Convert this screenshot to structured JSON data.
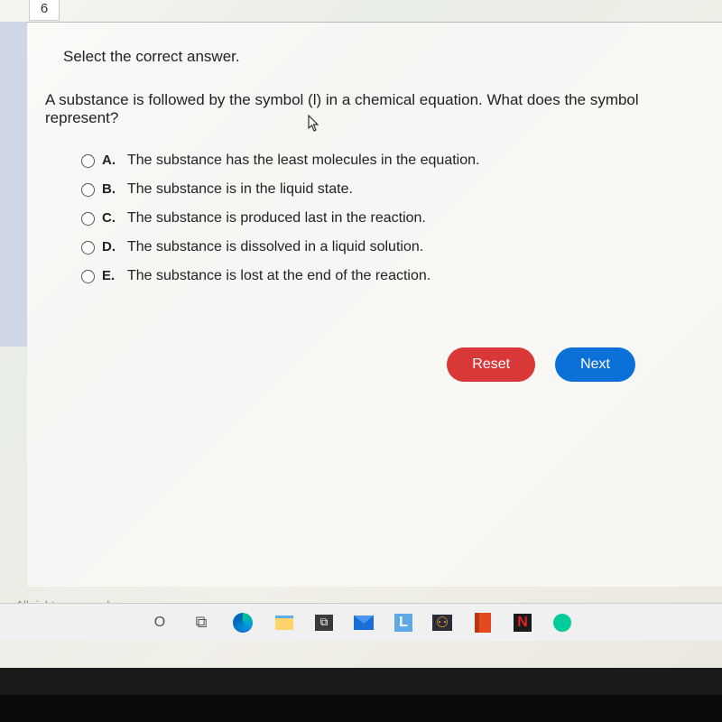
{
  "page_number": "6",
  "instruction": "Select the correct answer.",
  "question": "A substance is followed by the symbol (l) in a chemical equation. What does the symbol represent?",
  "options": [
    {
      "letter": "A.",
      "text": "The substance has the least molecules in the equation."
    },
    {
      "letter": "B.",
      "text": "The substance is in the liquid state."
    },
    {
      "letter": "C.",
      "text": "The substance is produced last in the reaction."
    },
    {
      "letter": "D.",
      "text": "The substance is dissolved in a liquid solution."
    },
    {
      "letter": "E.",
      "text": "The substance is lost at the end of the reaction."
    }
  ],
  "buttons": {
    "reset": "Reset",
    "next": "Next"
  },
  "footer": "m. All rights reserved.",
  "taskbar": {
    "search": "O",
    "taskview": "⧉",
    "store": "⧉",
    "l_app": "L",
    "game": "⚇",
    "netflix": "N"
  }
}
